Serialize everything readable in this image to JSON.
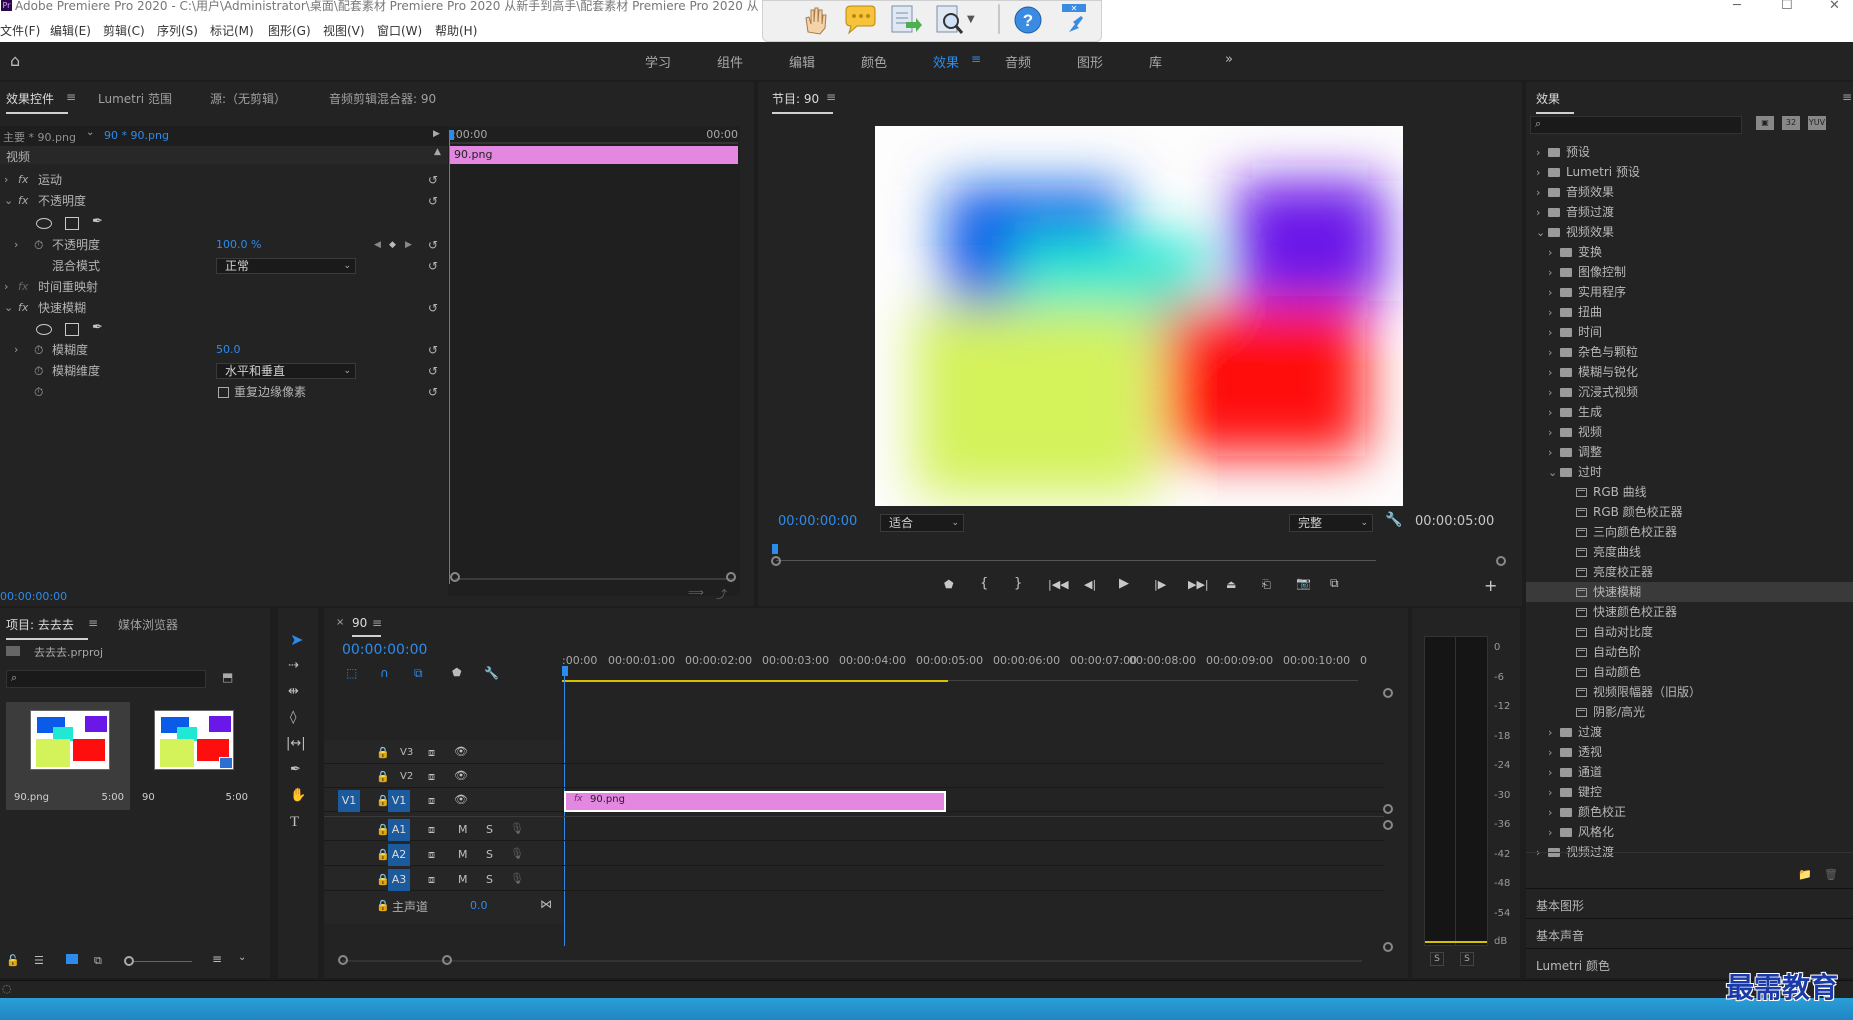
{
  "window": {
    "title": "Adobe Premiere Pro 2020 - C:\\用户\\Administrator\\桌面\\配套素材 Premiere Pro 2020 从新手到高手\\配套素材 Premiere Pro 2020 从",
    "app_icon": "Pr"
  },
  "menu": [
    "文件(F)",
    "编辑(E)",
    "剪辑(C)",
    "序列(S)",
    "标记(M)",
    "图形(G)",
    "视图(V)",
    "窗口(W)",
    "帮助(H)"
  ],
  "workspaces": {
    "items": [
      "学习",
      "组件",
      "编辑",
      "颜色",
      "效果",
      "音频",
      "图形",
      "库"
    ],
    "active": "效果",
    "more": "»"
  },
  "effect_controls": {
    "tabs": [
      "效果控件",
      "Lumetri 范围",
      "源:（无剪辑）",
      "音频剪辑混合器: 90"
    ],
    "master": "主要 * 90.png",
    "clip": "90 * 90.png",
    "ruler_start": ":00:00",
    "ruler_end": "00:00",
    "clip_bar": "90.png",
    "section": "视频",
    "rows": {
      "motion": "运动",
      "opacity": "不透明度",
      "opacity_prop": "不透明度",
      "opacity_value": "100.0 %",
      "blend_mode": "混合模式",
      "blend_value": "正常",
      "time_remap": "时间重映射",
      "fast_blur": "快速模糊",
      "blurriness": "模糊度",
      "blurriness_value": "50.0",
      "blur_dimension": "模糊维度",
      "blur_dimension_value": "水平和垂直",
      "repeat_edge": "重复边缘像素"
    },
    "fx_label": "fx",
    "timecode": "00:00:00:00"
  },
  "program_monitor": {
    "title": "节目: 90",
    "timecode": "00:00:00:00",
    "fit": "适合",
    "quality": "完整",
    "duration": "00:00:05:00"
  },
  "project": {
    "tabs": [
      "项目: 去去去",
      "媒体浏览器"
    ],
    "file": "去去去.prproj",
    "items": [
      {
        "name": "90.png",
        "duration": "5:00"
      },
      {
        "name": "90",
        "duration": "5:00"
      }
    ]
  },
  "timeline": {
    "tab": "90",
    "timecode": "00:00:00:00",
    "ruler": [
      ":00:00",
      "00:00:01:00",
      "00:00:02:00",
      "00:00:03:00",
      "00:00:04:00",
      "00:00:05:00",
      "00:00:06:00",
      "00:00:07:00",
      "00:00:08:00",
      "00:00:09:00",
      "00:00:10:00",
      "0"
    ],
    "video_tracks": [
      "V3",
      "V2",
      "V1"
    ],
    "audio_tracks": [
      "A1",
      "A2",
      "A3"
    ],
    "source_patch": "V1",
    "track_letters": {
      "mute": "M",
      "solo": "S"
    },
    "master": {
      "label": "主声道",
      "value": "0.0"
    },
    "clip": "90.png",
    "clip_fx": "fx"
  },
  "audio_meter": {
    "ticks": [
      "0",
      "-6",
      "-12",
      "-18",
      "-24",
      "-30",
      "-36",
      "-42",
      "-48",
      "-54",
      "dB"
    ],
    "solo": [
      "S",
      "S"
    ]
  },
  "effects_panel": {
    "title": "效果",
    "top": [
      {
        "label": "预设",
        "kind": "preset"
      },
      {
        "label": "Lumetri 预设",
        "kind": "preset"
      },
      {
        "label": "音频效果",
        "kind": "folder"
      },
      {
        "label": "音频过渡",
        "kind": "folder"
      }
    ],
    "video_effects": "视频效果",
    "video_children": [
      "变换",
      "图像控制",
      "实用程序",
      "扭曲",
      "时间",
      "杂色与颗粒",
      "模糊与锐化",
      "沉浸式视频",
      "生成",
      "视频",
      "调整"
    ],
    "obsolete": "过时",
    "obsolete_children": [
      "RGB 曲线",
      "RGB 颜色校正器",
      "三向颜色校正器",
      "亮度曲线",
      "亮度校正器",
      "快速模糊",
      "快速颜色校正器",
      "自动对比度",
      "自动色阶",
      "自动颜色",
      "视频限幅器（旧版）",
      "阴影/高光"
    ],
    "selected": "快速模糊",
    "after": [
      "过渡",
      "透视",
      "通道",
      "键控",
      "颜色校正",
      "风格化"
    ],
    "video_transitions": "视频过渡",
    "bottom_panels": [
      "基本图形",
      "基本声音",
      "Lumetri 颜色"
    ]
  },
  "watermark": "最需教育"
}
